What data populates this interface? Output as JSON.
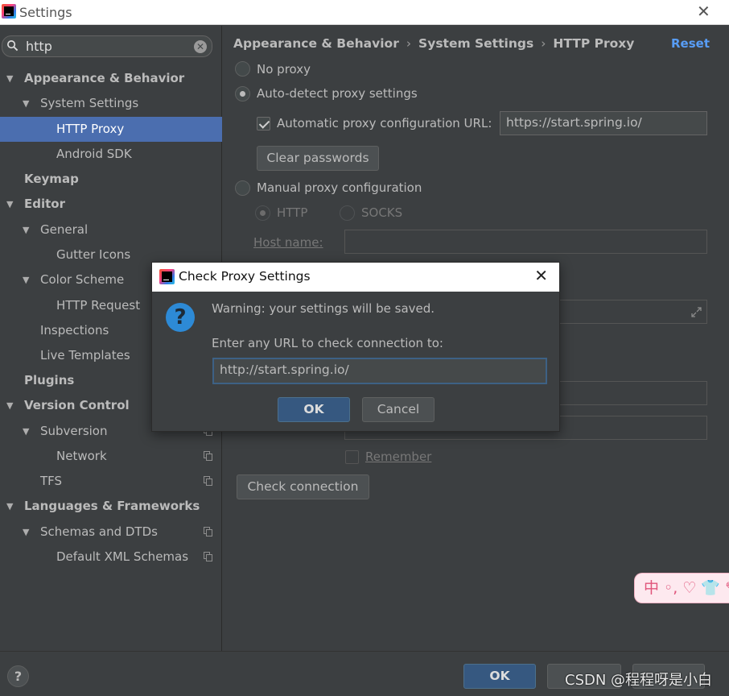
{
  "window": {
    "title": "Settings",
    "close_glyph": "✕"
  },
  "search": {
    "value": "http",
    "icon": "search-icon",
    "clear_glyph": "✕"
  },
  "tree": [
    {
      "label": "Appearance & Behavior",
      "bold": true,
      "expanded": true
    },
    {
      "label": "System Settings",
      "expanded": true
    },
    {
      "label": "HTTP Proxy",
      "selected": true
    },
    {
      "label": "Android SDK"
    },
    {
      "label": "Keymap",
      "bold": true
    },
    {
      "label": "Editor",
      "bold": true,
      "expanded": true
    },
    {
      "label": "General",
      "expanded": true
    },
    {
      "label": "Gutter Icons"
    },
    {
      "label": "Color Scheme",
      "expanded": true
    },
    {
      "label": "HTTP Request"
    },
    {
      "label": "Inspections"
    },
    {
      "label": "Live Templates"
    },
    {
      "label": "Plugins",
      "bold": true
    },
    {
      "label": "Version Control",
      "bold": true,
      "expanded": true
    },
    {
      "label": "Subversion",
      "expanded": true,
      "copy_icon": true
    },
    {
      "label": "Network",
      "copy_icon": true
    },
    {
      "label": "TFS",
      "copy_icon": true
    },
    {
      "label": "Languages & Frameworks",
      "bold": true,
      "expanded": true
    },
    {
      "label": "Schemas and DTDs",
      "expanded": true,
      "copy_icon": true
    },
    {
      "label": "Default XML Schemas",
      "copy_icon": true
    }
  ],
  "breadcrumb": [
    "Appearance & Behavior",
    "System Settings",
    "HTTP Proxy"
  ],
  "breadcrumb_sep": "›",
  "reset_label": "Reset",
  "proxy": {
    "no_proxy": "No proxy",
    "auto_detect": "Auto-detect proxy settings",
    "auto_config_label": "Automatic proxy configuration URL:",
    "auto_config_checked": true,
    "auto_config_url": "https://start.spring.io/",
    "clear_passwords": "Clear passwords",
    "manual": "Manual proxy configuration",
    "http": "HTTP",
    "socks": "SOCKS",
    "host_label": "Host name:",
    "remember": "Remember",
    "check_connection": "Check connection",
    "selected": "auto_detect"
  },
  "dialog": {
    "title": "Check Proxy Settings",
    "close_glyph": "✕",
    "warning": "Warning: your settings will be saved.",
    "prompt": "Enter any URL to check connection to:",
    "url": "http://start.spring.io/",
    "ok": "OK",
    "cancel": "Cancel",
    "icon_glyph": "?"
  },
  "footer": {
    "help": "?",
    "ok": "OK"
  },
  "watermark": "CSDN @程程呀是小白",
  "ime_toolbar": "中 ◦, ♡ 👕 ✎",
  "colors": {
    "selection": "#4b6eaf",
    "link": "#589df6",
    "default_button": "#365880"
  }
}
